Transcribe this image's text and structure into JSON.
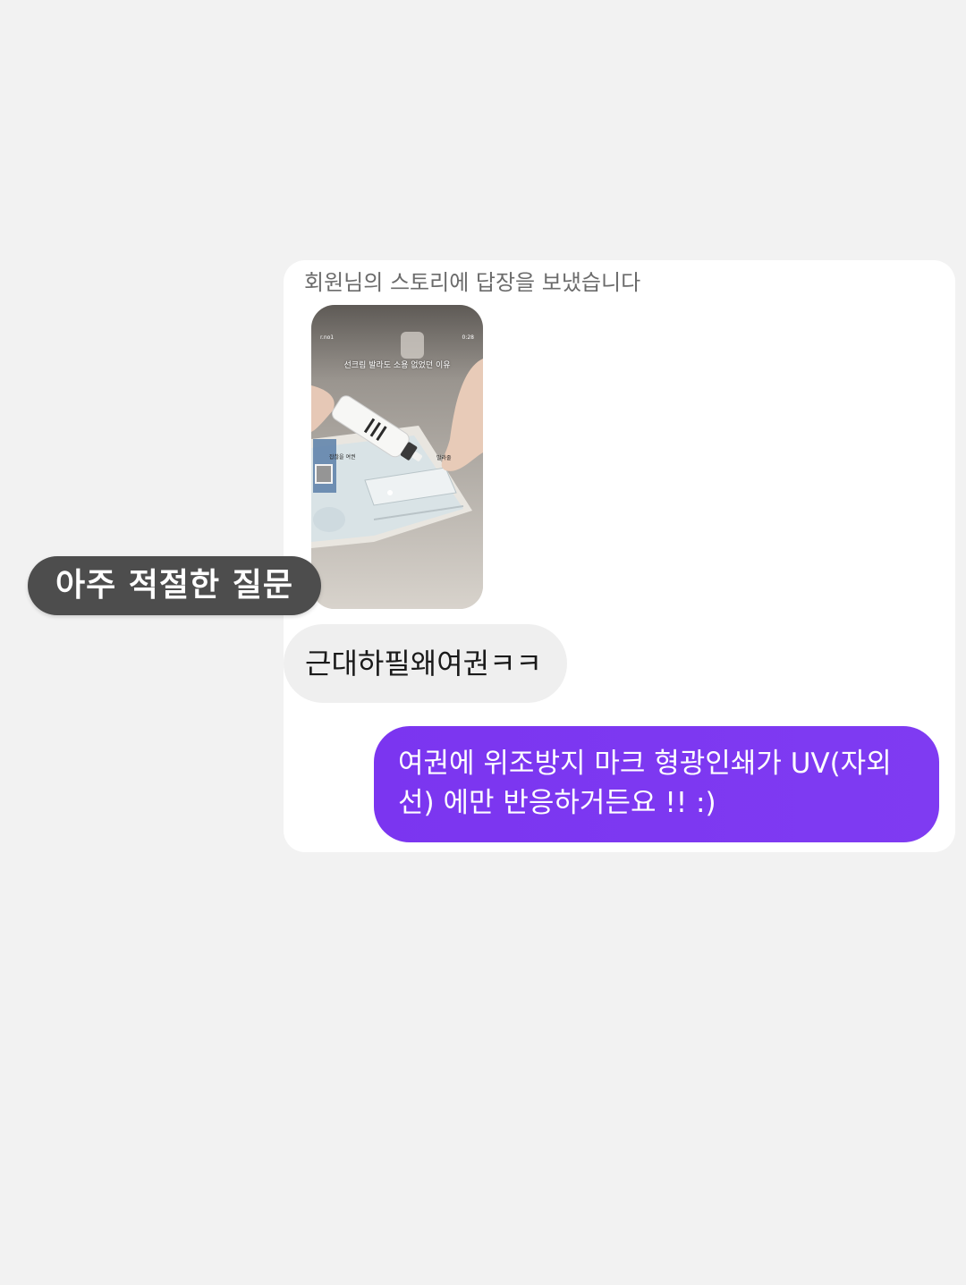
{
  "thread": {
    "reply_notice": "회원님의 스토리에 답장을 보냈습니다",
    "story_preview": {
      "username": "r.no1",
      "timestamp": "0:28",
      "caption": "선크림 발라도 소용 없었던 이유",
      "label_left": "잡찮을 여권",
      "label_right": "발라줄"
    },
    "messages": [
      {
        "sender": "other",
        "text": "근대하필왜여권ㅋㅋ"
      },
      {
        "sender": "me",
        "text": "여권에 위조방지 마크 형광인쇄가 UV(자외선) 에만 반응하거든요 !! :)"
      }
    ]
  },
  "caption_overlay": "아주 적절한 질문",
  "colors": {
    "background": "#f2f2f2",
    "card": "#ffffff",
    "received_bubble": "#efefef",
    "sent_bubble": "#7c3aed",
    "caption_pill": "#4d4d4d"
  }
}
